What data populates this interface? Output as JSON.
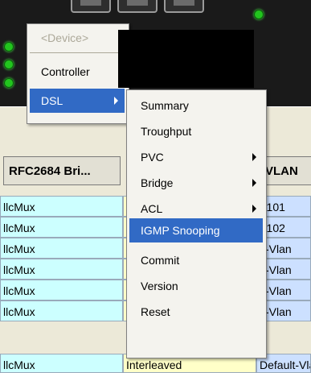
{
  "colors": {
    "menu_selection": "#316ac5",
    "led_green": "#22c41e"
  },
  "context_menu": {
    "items": [
      {
        "label": "<Device>",
        "disabled": true
      },
      {
        "label": "Controller",
        "has_submenu": false
      },
      {
        "label": "DSL",
        "has_submenu": true,
        "selected": true
      }
    ]
  },
  "dsl_submenu": {
    "items": [
      {
        "label": "Summary"
      },
      {
        "label": "Troughput"
      },
      {
        "label": "PVC",
        "has_submenu": true
      },
      {
        "label": "Bridge",
        "has_submenu": true
      },
      {
        "label": "ACL",
        "has_submenu": true
      },
      {
        "label": "IGMP Snooping",
        "selected": true
      },
      {
        "label": "Commit"
      },
      {
        "label": "Version"
      },
      {
        "label": "Reset"
      }
    ]
  },
  "table": {
    "headers": [
      "RFC2684 Bri...",
      "VLAN"
    ],
    "rows": [
      {
        "encap": "llcMux",
        "mode": "",
        "vlan": "( 101"
      },
      {
        "encap": "llcMux",
        "mode": "",
        "vlan": "( 102"
      },
      {
        "encap": "llcMux",
        "mode": "",
        "vlan": "lt-Vlan"
      },
      {
        "encap": "llcMux",
        "mode": "",
        "vlan": "lt-Vlan"
      },
      {
        "encap": "llcMux",
        "mode": "",
        "vlan": "lt-Vlan"
      },
      {
        "encap": "llcMux",
        "mode": "",
        "vlan": "lt-Vlan"
      },
      {
        "encap": "llcMux",
        "mode": "Interleaved",
        "vlan": "Default-Vlan"
      }
    ]
  }
}
